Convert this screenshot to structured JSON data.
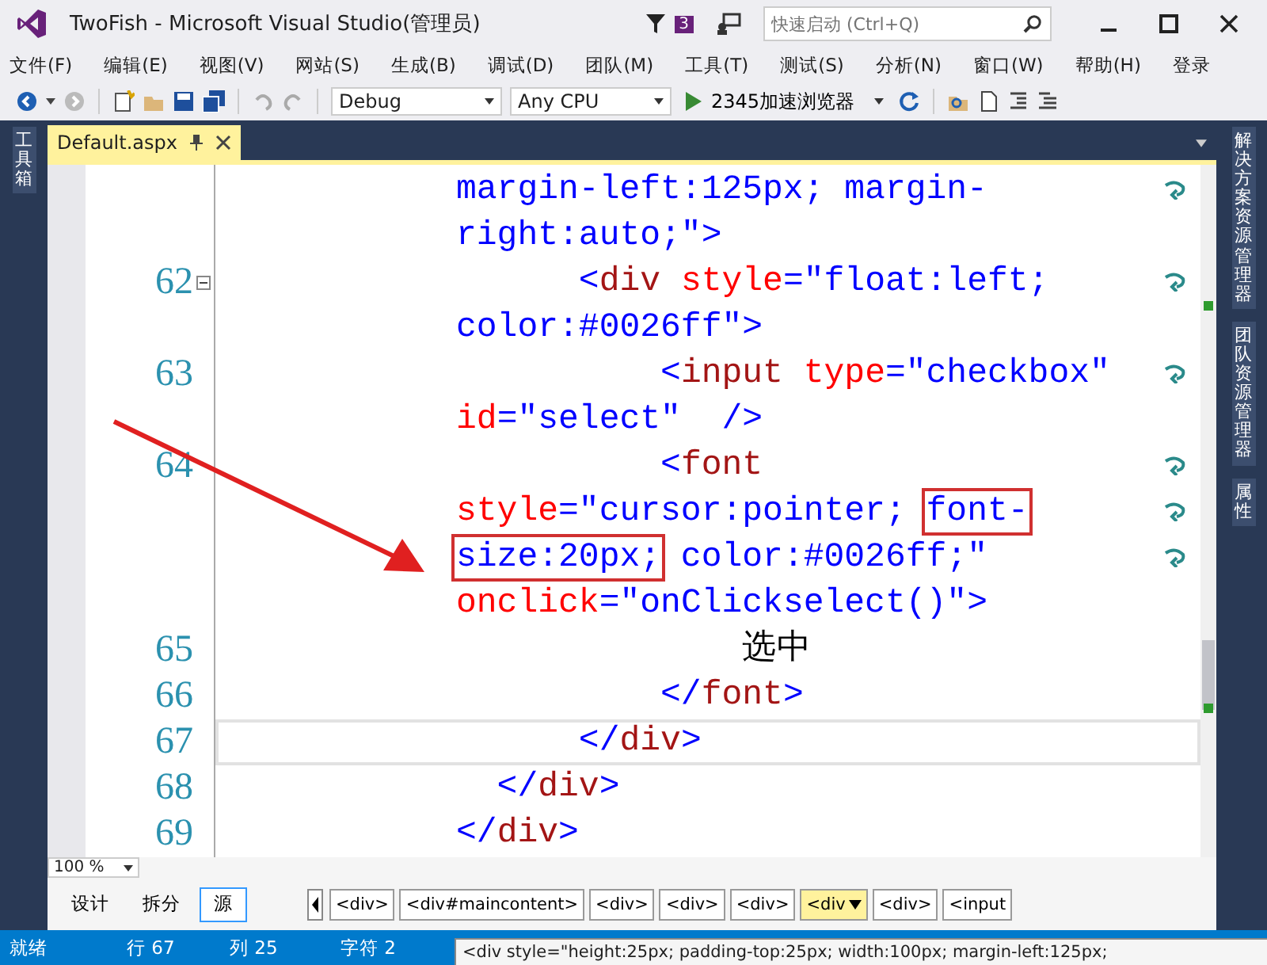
{
  "window": {
    "title": "TwoFish - Microsoft Visual Studio(管理员)",
    "notification_count": "3",
    "quick_launch": {
      "placeholder": "快速启动 (Ctrl+Q)"
    }
  },
  "menu": {
    "items": [
      "文件(F)",
      "编辑(E)",
      "视图(V)",
      "网站(S)",
      "生成(B)",
      "调试(D)",
      "团队(M)",
      "工具(T)",
      "测试(S)",
      "分析(N)",
      "窗口(W)",
      "帮助(H)"
    ],
    "sign_in": "登录"
  },
  "toolbar": {
    "configuration": "Debug",
    "platform": "Any CPU",
    "start": "2345加速浏览器"
  },
  "left_panel": {
    "tabs": [
      "工具箱"
    ]
  },
  "right_panel": {
    "tabs": [
      "解决方案资源管理器",
      "团队资源管理器",
      "属性"
    ]
  },
  "document_tab": {
    "title": "Default.aspx",
    "selected": true
  },
  "editor": {
    "lines": [
      {
        "fold": false,
        "wrap": true,
        "current": false,
        "tokens": [
          {
            "kind": "val",
            "text": "margin-left:125px; margin-"
          }
        ]
      },
      {
        "fold": false,
        "wrap": false,
        "current": false,
        "tokens": [
          {
            "kind": "val",
            "text": "right:auto;\""
          },
          {
            "kind": "p",
            "text": ">"
          }
        ]
      },
      {
        "number": "62",
        "fold": true,
        "wrap": true,
        "current": false,
        "tokens": [
          {
            "kind": "p",
            "text": "      <"
          },
          {
            "kind": "tag",
            "text": "div "
          },
          {
            "kind": "attr",
            "text": "style"
          },
          {
            "kind": "p",
            "text": "="
          },
          {
            "kind": "val",
            "text": "\"float:left;"
          }
        ]
      },
      {
        "fold": false,
        "wrap": false,
        "current": false,
        "tokens": [
          {
            "kind": "val",
            "text": "color:#0026ff\""
          },
          {
            "kind": "p",
            "text": ">"
          }
        ]
      },
      {
        "number": "63",
        "fold": false,
        "wrap": true,
        "current": false,
        "tokens": [
          {
            "kind": "p",
            "text": "          <"
          },
          {
            "kind": "tag",
            "text": "input "
          },
          {
            "kind": "attr",
            "text": "type"
          },
          {
            "kind": "p",
            "text": "="
          },
          {
            "kind": "val",
            "text": "\"checkbox\""
          }
        ]
      },
      {
        "fold": false,
        "wrap": false,
        "current": false,
        "tokens": [
          {
            "kind": "attr",
            "text": "id"
          },
          {
            "kind": "p",
            "text": "="
          },
          {
            "kind": "val",
            "text": "\"select\"  "
          },
          {
            "kind": "p",
            "text": "/>"
          }
        ]
      },
      {
        "number": "64",
        "fold": false,
        "wrap": true,
        "current": false,
        "tokens": [
          {
            "kind": "p",
            "text": "          <"
          },
          {
            "kind": "tag",
            "text": "font"
          }
        ]
      },
      {
        "fold": false,
        "wrap": true,
        "current": false,
        "tokens": [
          {
            "kind": "attr",
            "text": "style"
          },
          {
            "kind": "p",
            "text": "="
          },
          {
            "kind": "val",
            "text": "\"cursor:pointer; "
          },
          {
            "kind": "val",
            "text": "font-",
            "boxed": true
          }
        ]
      },
      {
        "fold": false,
        "wrap": true,
        "current": false,
        "tokens": [
          {
            "kind": "val",
            "text": "size:20px;",
            "boxed": true
          },
          {
            "kind": "val",
            "text": " color:#0026ff;\""
          }
        ]
      },
      {
        "fold": false,
        "wrap": false,
        "current": false,
        "tokens": [
          {
            "kind": "attr",
            "text": "onclick"
          },
          {
            "kind": "p",
            "text": "="
          },
          {
            "kind": "val",
            "text": "\"onClickselect()\""
          },
          {
            "kind": "p",
            "text": ">"
          }
        ]
      },
      {
        "number": "65",
        "fold": false,
        "wrap": false,
        "current": false,
        "tokens": [
          {
            "kind": "text",
            "text": "              选中"
          }
        ]
      },
      {
        "number": "66",
        "fold": false,
        "wrap": false,
        "current": false,
        "tokens": [
          {
            "kind": "p",
            "text": "          </"
          },
          {
            "kind": "tag",
            "text": "font"
          },
          {
            "kind": "p",
            "text": ">"
          }
        ]
      },
      {
        "number": "67",
        "fold": false,
        "wrap": false,
        "current": true,
        "tokens": [
          {
            "kind": "p",
            "text": "      </"
          },
          {
            "kind": "tag",
            "text": "div"
          },
          {
            "kind": "p",
            "text": ">"
          }
        ]
      },
      {
        "number": "68",
        "fold": false,
        "wrap": false,
        "current": false,
        "tokens": [
          {
            "kind": "p",
            "text": "  </"
          },
          {
            "kind": "tag",
            "text": "div"
          },
          {
            "kind": "p",
            "text": ">"
          }
        ]
      },
      {
        "number": "69",
        "fold": false,
        "wrap": false,
        "current": false,
        "tokens": [
          {
            "kind": "p",
            "text": "</"
          },
          {
            "kind": "tag",
            "text": "div"
          },
          {
            "kind": "p",
            "text": ">"
          }
        ]
      }
    ]
  },
  "zoom": "100 %",
  "view_buttons": [
    {
      "label": "设计",
      "selected": false
    },
    {
      "label": "拆分",
      "selected": false
    },
    {
      "label": "源",
      "selected": true
    }
  ],
  "breadcrumb": [
    {
      "label": "<div>",
      "selected": false
    },
    {
      "label": "<div#maincontent>",
      "selected": false
    },
    {
      "label": "<div>",
      "selected": false
    },
    {
      "label": "<div>",
      "selected": false
    },
    {
      "label": "<div>",
      "selected": false
    },
    {
      "label": "<div",
      "selected": true
    },
    {
      "label": "<div>",
      "selected": false
    },
    {
      "label": "<input",
      "selected": false
    }
  ],
  "status_bar": {
    "state": "就绪",
    "line": "行 67",
    "column": "列 25",
    "char": "字符 2"
  },
  "tooltip": "<div style=\"height:25px; padding-top:25px; width:100px; margin-left:125px;"
}
